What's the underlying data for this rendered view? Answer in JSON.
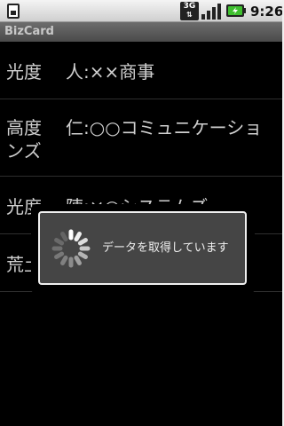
{
  "status_bar": {
    "time": "9:26",
    "network_label": "3G",
    "icons": [
      "sim-card-icon",
      "3g-icon",
      "signal-icon",
      "battery-charging-icon"
    ]
  },
  "app": {
    "title": "BizCard"
  },
  "contacts": [
    {
      "name": "光度",
      "company": "人:××商事"
    },
    {
      "name": "高度ンズ",
      "company": "仁:○○コミュニケーショ"
    },
    {
      "name": "光度",
      "company": "陣:×○システムズ"
    },
    {
      "name": "荒土",
      "company": ""
    }
  ],
  "dialog": {
    "message": "データを取得しています",
    "icon": "loading-spinner-icon"
  },
  "colors": {
    "background": "#000000",
    "text": "#d0d0d0",
    "dialog_bg": "#454545",
    "battery_accent": "#3fbf2f"
  }
}
